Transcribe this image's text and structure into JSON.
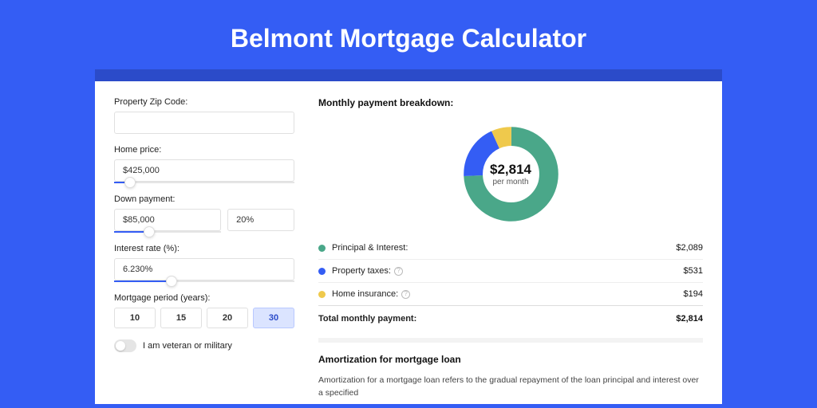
{
  "title": "Belmont Mortgage Calculator",
  "form": {
    "zip_label": "Property Zip Code:",
    "zip_value": "",
    "home_price_label": "Home price:",
    "home_price_value": "$425,000",
    "home_price_slider_pct": 9,
    "down_label": "Down payment:",
    "down_value": "$85,000",
    "down_pct": "20%",
    "down_slider_pct": 20,
    "rate_label": "Interest rate (%):",
    "rate_value": "6.230%",
    "rate_slider_pct": 32,
    "period_label": "Mortgage period (years):",
    "periods": [
      "10",
      "15",
      "20",
      "30"
    ],
    "period_selected": "30",
    "veteran_label": "I am veteran or military"
  },
  "breakdown": {
    "title": "Monthly payment breakdown:",
    "center_amount": "$2,814",
    "center_sub": "per month",
    "items": [
      {
        "key": "principal_interest",
        "label": "Principal & Interest:",
        "value": "$2,089",
        "color": "green",
        "info": false
      },
      {
        "key": "property_taxes",
        "label": "Property taxes:",
        "value": "$531",
        "color": "blue",
        "info": true
      },
      {
        "key": "home_insurance",
        "label": "Home insurance:",
        "value": "$194",
        "color": "yellow",
        "info": true
      }
    ],
    "total_label": "Total monthly payment:",
    "total_value": "$2,814"
  },
  "amortization": {
    "title": "Amortization for mortgage loan",
    "body": "Amortization for a mortgage loan refers to the gradual repayment of the loan principal and interest over a specified"
  },
  "chart_data": {
    "type": "pie",
    "title": "Monthly payment breakdown",
    "subtitle": "$2,814 per month",
    "series": [
      {
        "name": "Principal & Interest",
        "value": 2089,
        "color": "#4aa789"
      },
      {
        "name": "Property taxes",
        "value": 531,
        "color": "#345df4"
      },
      {
        "name": "Home insurance",
        "value": 194,
        "color": "#efc94c"
      }
    ],
    "total": 2814,
    "inner_radius_pct": 62
  }
}
